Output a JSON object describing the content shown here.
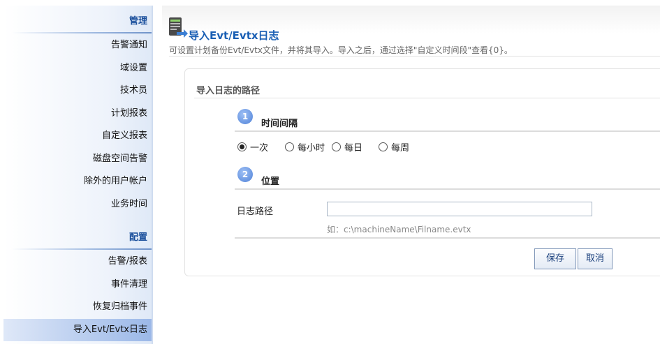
{
  "sidebar": {
    "section_manage": "管理",
    "manage_items": [
      {
        "label": "告警通知"
      },
      {
        "label": "域设置"
      },
      {
        "label": "技术员"
      },
      {
        "label": "计划报表"
      },
      {
        "label": "自定义报表"
      },
      {
        "label": "磁盘空间告警"
      },
      {
        "label": "除外的用户帐户"
      },
      {
        "label": "业务时间"
      }
    ],
    "section_config": "配置",
    "config_items": [
      {
        "label": "告警/报表"
      },
      {
        "label": "事件清理"
      },
      {
        "label": "恢复归档事件"
      },
      {
        "label": "导入Evt/Evtx日志",
        "active": true
      }
    ]
  },
  "header": {
    "title": "导入Evt/Evtx日志",
    "description": "可设置计划备份Evt/Evtx文件，并将其导入。导入之后，通过选择\"自定义时间段\"查看{0}。"
  },
  "panel": {
    "title": "导入日志的路径",
    "step1": {
      "number": "1",
      "label": "时间间隔"
    },
    "intervals": [
      {
        "label": "一次",
        "checked": true
      },
      {
        "label": "每小时",
        "checked": false
      },
      {
        "label": "每日",
        "checked": false
      },
      {
        "label": "每周",
        "checked": false
      }
    ],
    "step2": {
      "number": "2",
      "label": "位置"
    },
    "path_label": "日志路径",
    "path_value": "",
    "path_hint": "如：c:\\machineName\\Filname.evtx",
    "save_label": "保存",
    "cancel_label": "取消"
  },
  "colors": {
    "accent": "#1a5fb4",
    "step_circle": "#4f82d8",
    "active_nav": "#9bb8e8"
  }
}
